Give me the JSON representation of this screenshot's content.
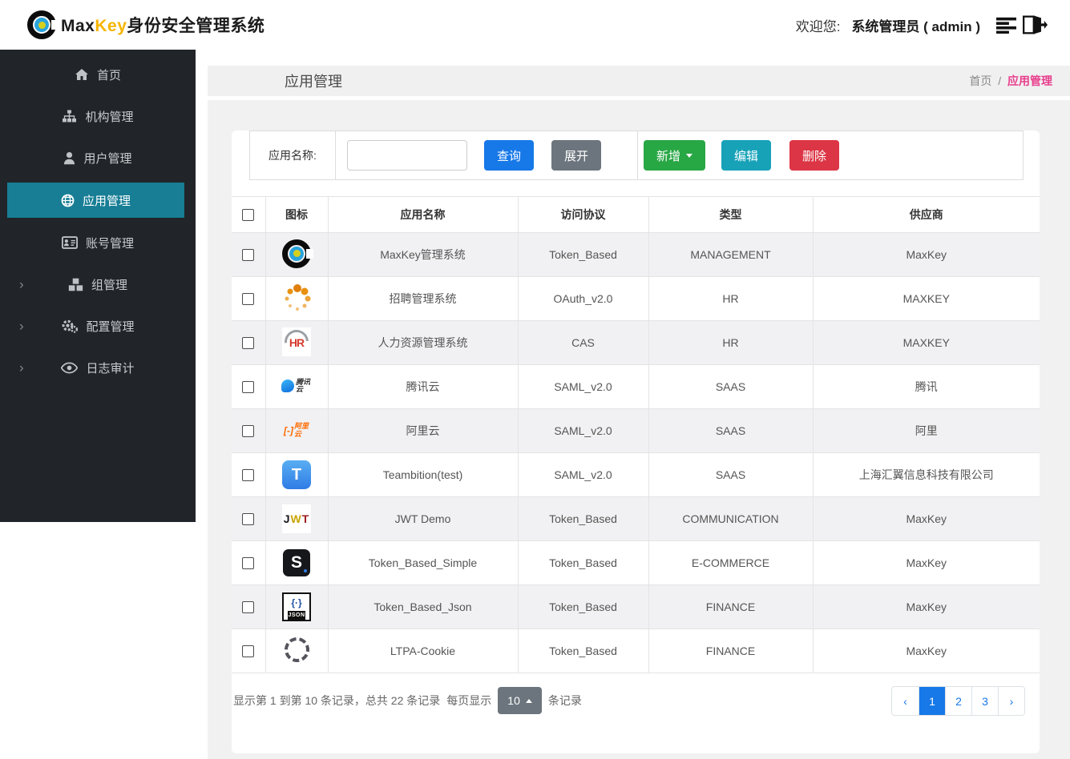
{
  "brand": {
    "name_part1": "Max",
    "name_part2": "Key",
    "name_suffix": "身份安全管理系统"
  },
  "header": {
    "welcome_label": "欢迎您:",
    "username": "系统管理员 ( admin )"
  },
  "sidebar": {
    "items": [
      {
        "label": "首页",
        "icon": "home-icon",
        "active": false,
        "chevron": false
      },
      {
        "label": "机构管理",
        "icon": "sitemap-icon",
        "active": false,
        "chevron": false
      },
      {
        "label": "用户管理",
        "icon": "user-icon",
        "active": false,
        "chevron": false
      },
      {
        "label": "应用管理",
        "icon": "globe-icon",
        "active": true,
        "chevron": false
      },
      {
        "label": "账号管理",
        "icon": "id-card-icon",
        "active": false,
        "chevron": false
      },
      {
        "label": "组管理",
        "icon": "cubes-icon",
        "active": false,
        "chevron": true
      },
      {
        "label": "配置管理",
        "icon": "gears-icon",
        "active": false,
        "chevron": true
      },
      {
        "label": "日志审计",
        "icon": "eye-icon",
        "active": false,
        "chevron": true
      }
    ]
  },
  "page": {
    "title": "应用管理",
    "breadcrumb_home": "首页",
    "breadcrumb_separator": "/",
    "breadcrumb_current": "应用管理"
  },
  "toolbar": {
    "search_label": "应用名称:",
    "search_value": "",
    "query_button": "查询",
    "expand_button": "展开",
    "add_button": "新增",
    "edit_button": "编辑",
    "delete_button": "删除"
  },
  "table": {
    "columns": [
      "图标",
      "应用名称",
      "访问协议",
      "类型",
      "供应商"
    ],
    "rows": [
      {
        "icon": "maxkey",
        "name": "MaxKey管理系统",
        "protocol": "Token_Based",
        "type": "MANAGEMENT",
        "vendor": "MaxKey"
      },
      {
        "icon": "spinner",
        "name": "招聘管理系统",
        "protocol": "OAuth_v2.0",
        "type": "HR",
        "vendor": "MAXKEY"
      },
      {
        "icon": "hr",
        "name": "人力资源管理系统",
        "protocol": "CAS",
        "type": "HR",
        "vendor": "MAXKEY"
      },
      {
        "icon": "tencent",
        "name": "腾讯云",
        "protocol": "SAML_v2.0",
        "type": "SAAS",
        "vendor": "腾讯"
      },
      {
        "icon": "aliyun",
        "name": "阿里云",
        "protocol": "SAML_v2.0",
        "type": "SAAS",
        "vendor": "阿里"
      },
      {
        "icon": "teambition",
        "name": "Teambition(test)",
        "protocol": "SAML_v2.0",
        "type": "SAAS",
        "vendor": "上海汇翼信息科技有限公司"
      },
      {
        "icon": "jwt",
        "name": "JWT Demo",
        "protocol": "Token_Based",
        "type": "COMMUNICATION",
        "vendor": "MaxKey"
      },
      {
        "icon": "sblack",
        "name": "Token_Based_Simple",
        "protocol": "Token_Based",
        "type": "E-COMMERCE",
        "vendor": "MaxKey"
      },
      {
        "icon": "json",
        "name": "Token_Based_Json",
        "protocol": "Token_Based",
        "type": "FINANCE",
        "vendor": "MaxKey"
      },
      {
        "icon": "ltpa",
        "name": "LTPA-Cookie",
        "protocol": "Token_Based",
        "type": "FINANCE",
        "vendor": "MaxKey"
      }
    ]
  },
  "footer": {
    "summary_prefix": "显示第 1 到第 10 条记录，总共 22 条记录",
    "per_page_label": "每页显示",
    "page_size": "10",
    "records_suffix": "条记录",
    "pagination": {
      "prev": "‹",
      "next": "›",
      "pages": [
        "1",
        "2",
        "3"
      ],
      "active_page": "1"
    }
  },
  "colors": {
    "sidebar_bg": "#212529",
    "sidebar_active": "#177e95",
    "accent_blue": "#1778e8",
    "green": "#28a745",
    "teal": "#17a2b8",
    "red": "#dc3545",
    "gray_button": "#6c757d",
    "breadcrumb_active": "#e83e8c",
    "brand_yellow": "#f7b500",
    "stripe": "#f1f1f3"
  }
}
